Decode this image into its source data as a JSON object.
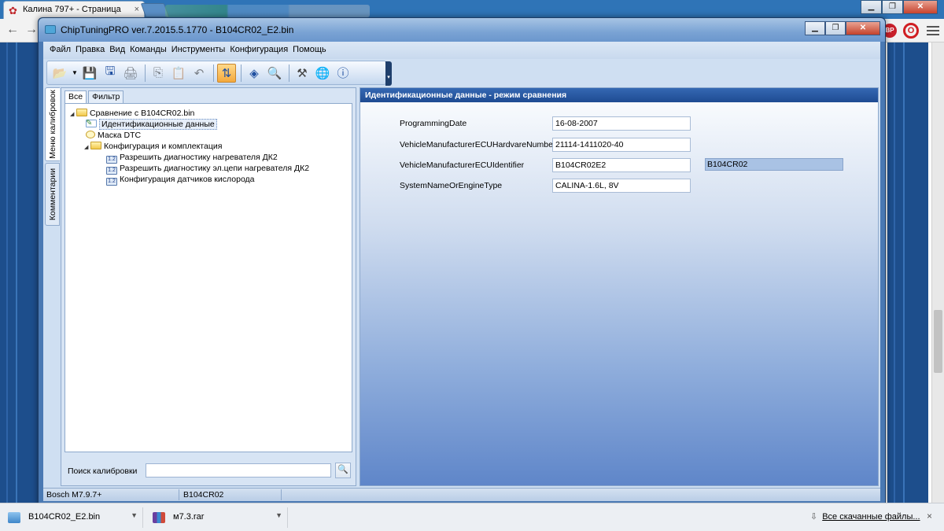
{
  "browser": {
    "tab_title": "Калина 797+ - Страница",
    "tab_close": "×",
    "back": "←",
    "forward": "→",
    "ext_badge": "BP",
    "ext_opera": "O"
  },
  "app": {
    "title": "ChipTuningPRO ver.7.2015.5.1770 - B104CR02_E2.bin",
    "menu": [
      "Файл",
      "Правка",
      "Вид",
      "Команды",
      "Инструменты",
      "Конфигурация",
      "Помощь"
    ],
    "side_tabs": {
      "calibration_menu": "Меню калибровок",
      "comments": "Комментарии"
    },
    "left_tabs": {
      "all": "Все",
      "filter": "Фильтр"
    },
    "tree": {
      "root": "Сравнение с B104CR02.bin",
      "identification": "Идентификационные данные",
      "dtc_mask": "Маска DTC",
      "config": "Конфигурация и комплектация",
      "params": [
        "Разрешить диагностику нагревателя ДК2",
        "Разрешить диагностику эл.цепи нагревателя ДК2",
        "Конфигурация датчиков кислорода"
      ],
      "param_icon_text": "1.2"
    },
    "search": {
      "label": "Поиск калибровки",
      "value": ""
    },
    "panel_title": "Идентификационные данные - режим сравнения",
    "fields": [
      {
        "label": "ProgrammingDate",
        "value": "16-08-2007",
        "compare": ""
      },
      {
        "label": "VehicleManufacturerECUHardvareNumber",
        "value": "21114-1411020-40",
        "compare": ""
      },
      {
        "label": "VehicleManufacturerECUIdentifier",
        "value": "B104CR02E2",
        "compare": "B104CR02"
      },
      {
        "label": "SystemNameOrEngineType",
        "value": "CALINA-1.6L, 8V",
        "compare": ""
      }
    ],
    "status": {
      "ecu": "Bosch M7.9.7+",
      "compare_file": "B104CR02"
    }
  },
  "downloads": {
    "items": [
      {
        "name": "B104CR02_E2.bin"
      },
      {
        "name": "м7.3.rar"
      }
    ],
    "show_all": "Все скачанные файлы...",
    "close": "×"
  },
  "colors": {
    "panel_header": "#1e4b92",
    "compare_field": "#a9c2e4",
    "active_tool": "#f4a93c"
  },
  "icons": [
    "open-icon",
    "save-icon",
    "save-as-icon",
    "print-icon",
    "copy-icon",
    "paste-icon",
    "undo-icon",
    "compare-icon",
    "info-icon",
    "search-zoom-icon",
    "tools-icon",
    "web-update-icon",
    "help-icon"
  ]
}
